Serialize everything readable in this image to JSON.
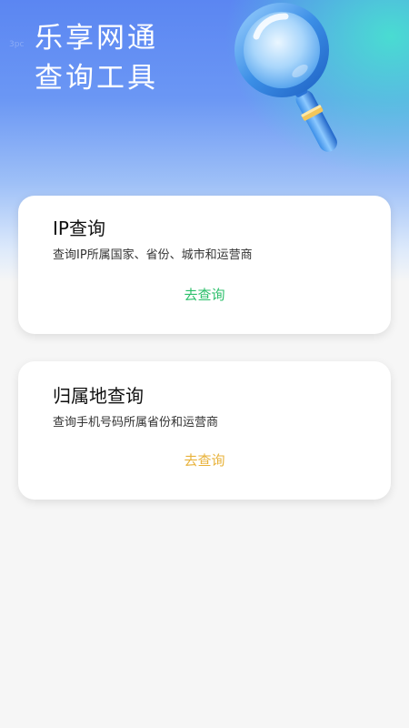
{
  "header": {
    "title_line1": "乐享网通",
    "title_line2": "查询工具",
    "watermark": "3pc",
    "icon": "magnifier-icon",
    "gradient_colors": [
      "#5b86f2",
      "#48e0d0",
      "#f6f6f6"
    ]
  },
  "cards": [
    {
      "title": "IP查询",
      "description": "查询IP所属国家、省份、城市和运营商",
      "action_label": "去查询",
      "action_color": "#2bbf6a"
    },
    {
      "title": "归属地查询",
      "description": "查询手机号码所属省份和运营商",
      "action_label": "去查询",
      "action_color": "#e8b23a"
    }
  ]
}
